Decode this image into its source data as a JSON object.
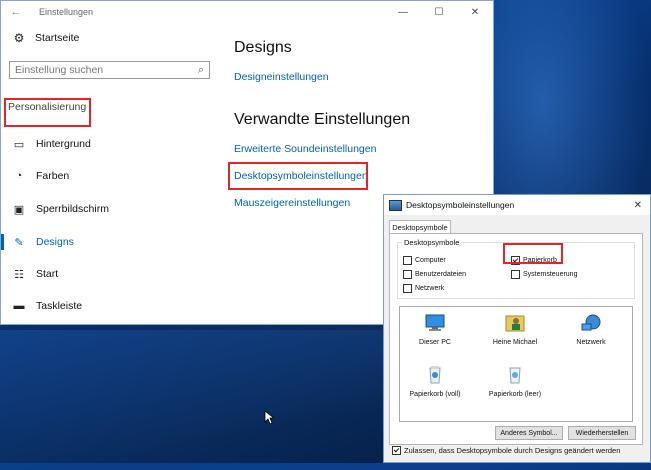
{
  "settings_window": {
    "title": "Einstellungen",
    "back_glyph": "←",
    "controls": {
      "minimize": "—",
      "maximize": "☐",
      "close": "✕"
    },
    "sidebar": {
      "home": {
        "label": "Startseite",
        "icon": "gear-icon"
      },
      "search": {
        "placeholder": "Einstellung suchen",
        "icon": "search-icon"
      },
      "section": "Personalisierung",
      "items": [
        {
          "label": "Hintergrund",
          "icon": "picture-icon"
        },
        {
          "label": "Farben",
          "icon": "palette-icon"
        },
        {
          "label": "Sperrbildschirm",
          "icon": "lockscreen-icon"
        },
        {
          "label": "Designs",
          "icon": "brush-icon",
          "active": true
        },
        {
          "label": "Start",
          "icon": "start-icon"
        },
        {
          "label": "Taskleiste",
          "icon": "taskbar-icon"
        }
      ]
    },
    "main": {
      "heading": "Designs",
      "design_settings_link": "Designeinstellungen",
      "related_heading": "Verwandte Einstellungen",
      "links": [
        "Erweiterte Soundeinstellungen",
        "Desktopsymboleinstellungen",
        "Mauszeigereinstellungen"
      ]
    }
  },
  "dialog": {
    "title": "Desktopsymboleinstellungen",
    "close": "✕",
    "tab": "Desktopsymbole",
    "group_label": "Desktopsymbole",
    "checkboxes": [
      {
        "label": "Computer",
        "checked": false
      },
      {
        "label": "Papierkorb",
        "checked": true
      },
      {
        "label": "Benutzerdateien",
        "checked": false
      },
      {
        "label": "Systemsteuerung",
        "checked": false
      },
      {
        "label": "Netzwerk",
        "checked": false
      }
    ],
    "icons": [
      {
        "label": "Dieser PC",
        "icon": "pc-icon"
      },
      {
        "label": "Heine Michael",
        "icon": "user-folder-icon"
      },
      {
        "label": "Netzwerk",
        "icon": "network-icon"
      },
      {
        "label": "Papierkorb (voll)",
        "icon": "recycle-bin-full-icon"
      },
      {
        "label": "Papierkorb (leer)",
        "icon": "recycle-bin-empty-icon"
      }
    ],
    "buttons": {
      "change_icon": "Anderes Symbol...",
      "restore": "Wiederherstellen"
    },
    "allow_label": "Zulassen, dass Desktopsymbole durch Designs geändert werden",
    "allow_checked": true
  },
  "colors": {
    "accent": "#0063b1",
    "highlight": "#e0252b"
  }
}
